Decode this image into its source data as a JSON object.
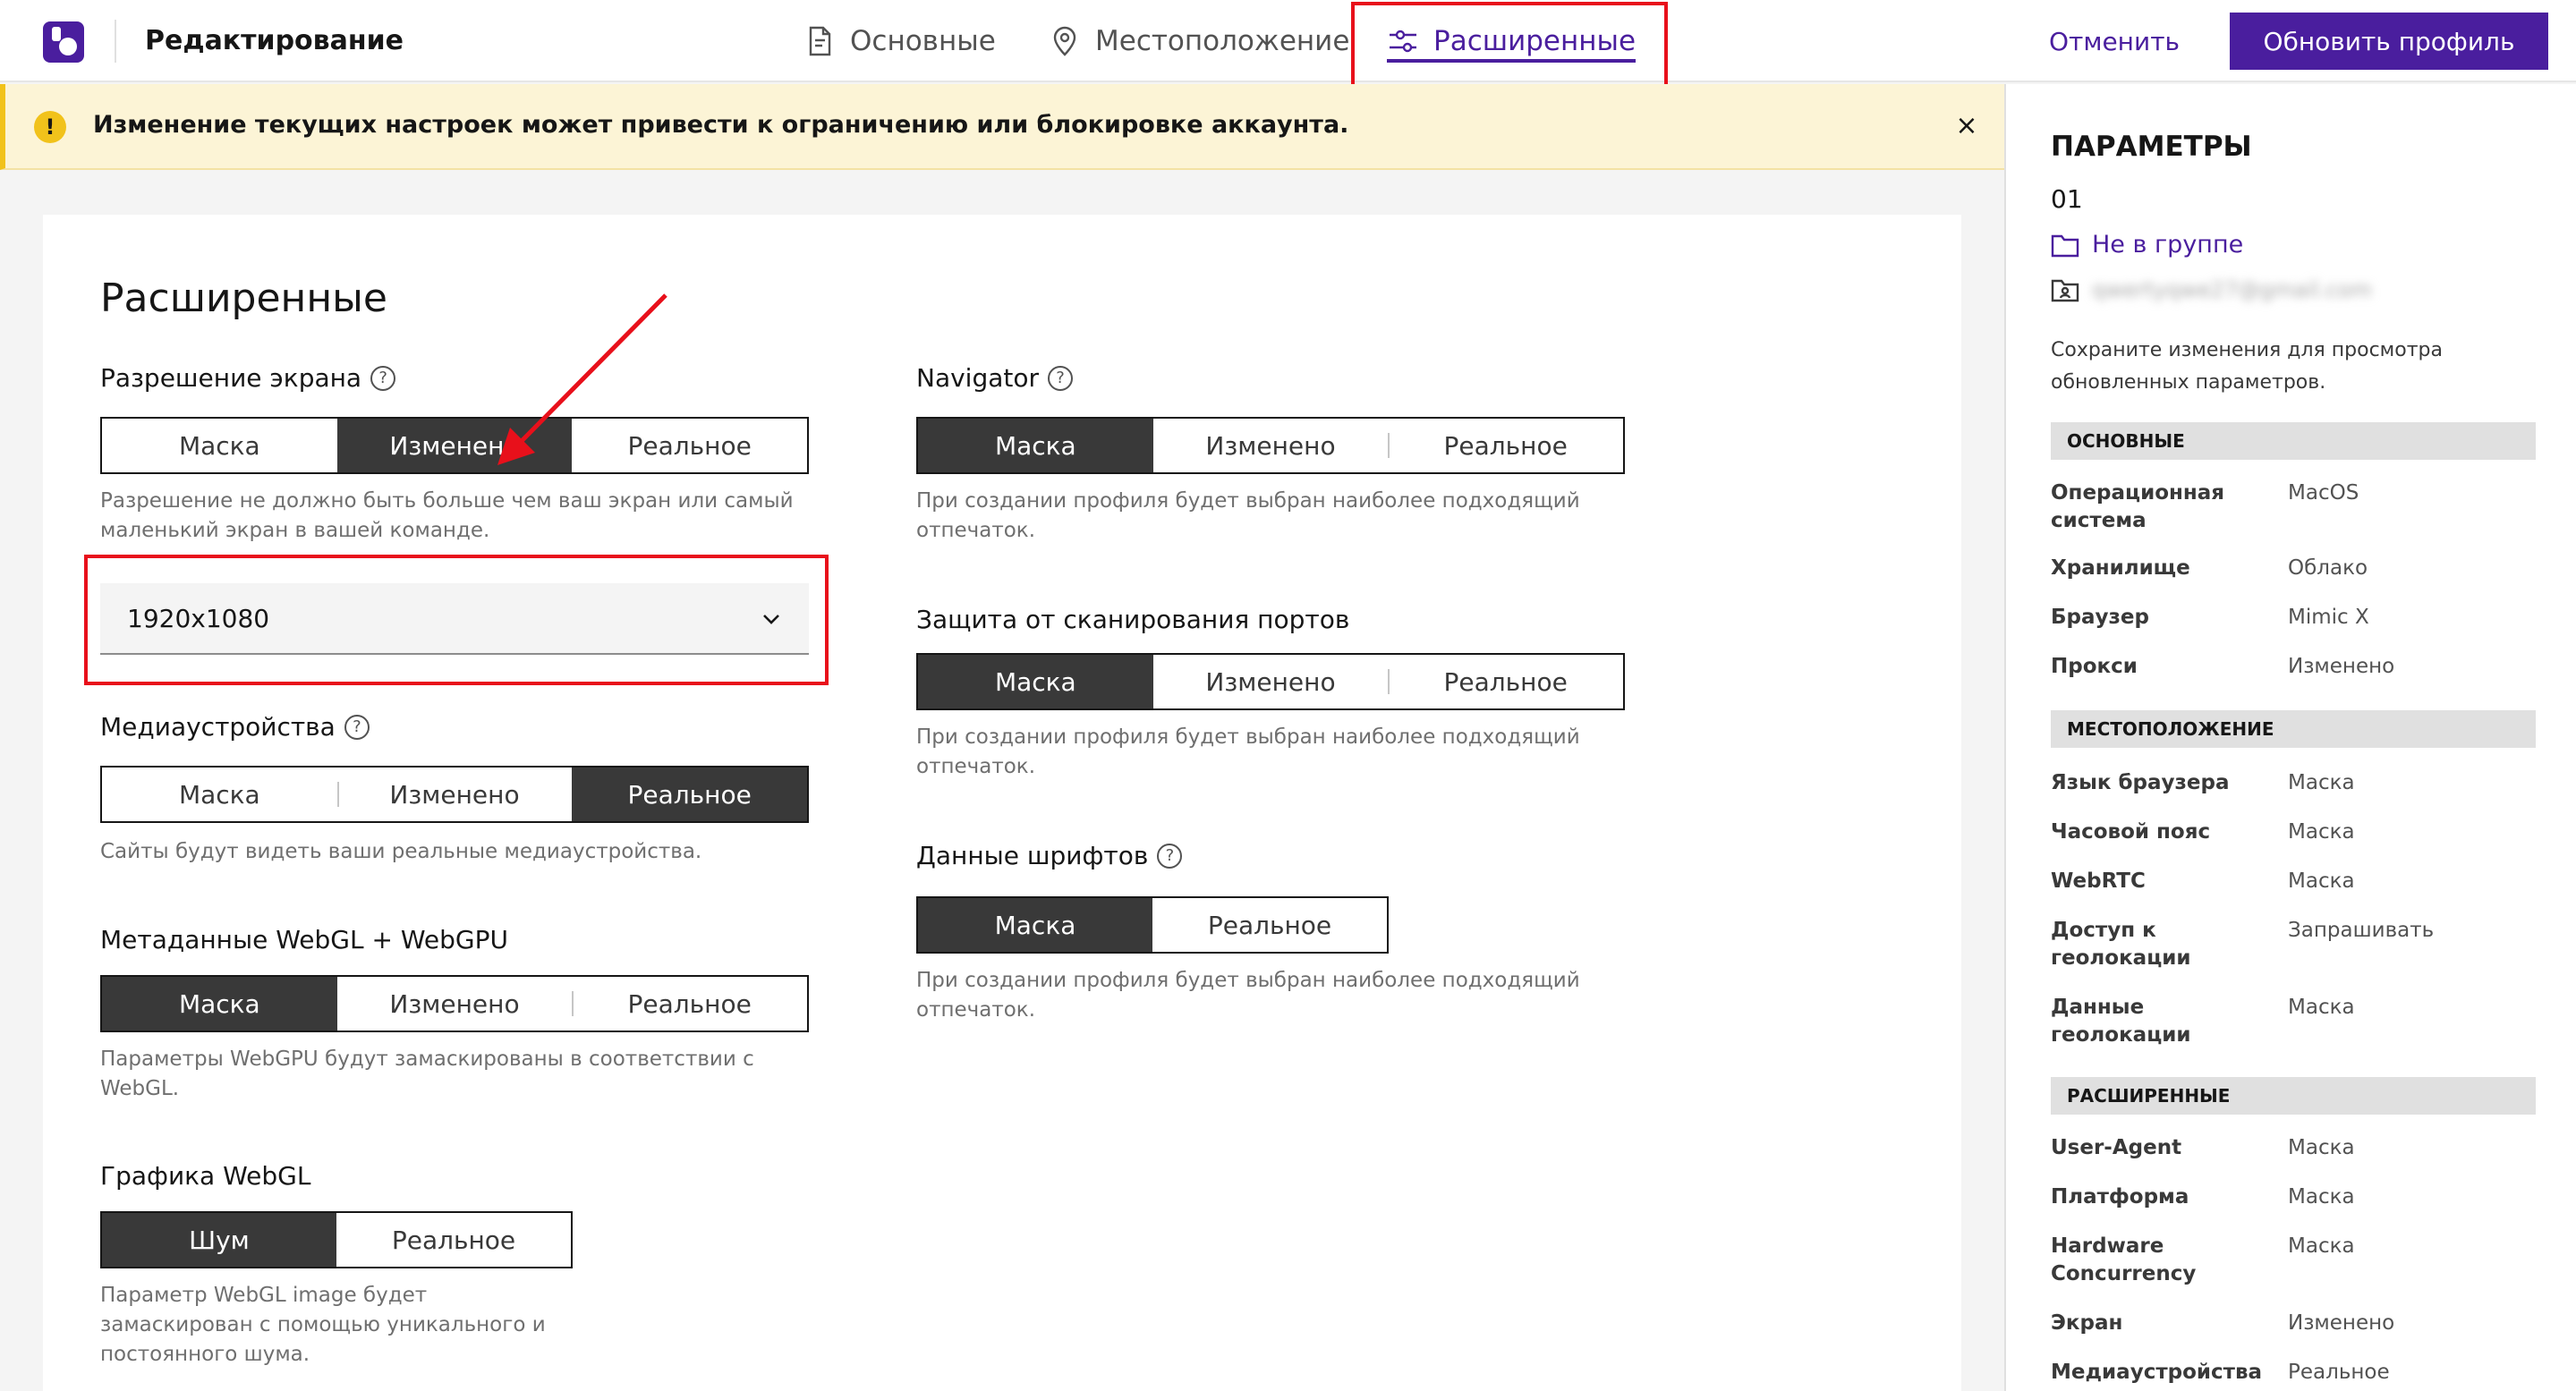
{
  "header": {
    "title": "Редактирование",
    "tabs": [
      {
        "label": "Основные",
        "icon": "document-icon"
      },
      {
        "label": "Местоположение",
        "icon": "location-pin-icon"
      },
      {
        "label": "Расширенные",
        "icon": "sliders-icon",
        "active": true
      }
    ],
    "cancel_label": "Отменить",
    "update_label": "Обновить профиль",
    "accent_color": "#4a1e9e"
  },
  "warning": {
    "icon": "!",
    "text": "Изменение текущих настроек может привести к ограничению или блокировке аккаунта.",
    "close": "×"
  },
  "main": {
    "title": "Расширенные",
    "screen_resolution": {
      "label": "Разрешение экрана",
      "options": [
        "Маска",
        "Изменено",
        "Реальное"
      ],
      "selected": "Изменено",
      "helper": "Разрешение не должно быть больше чем ваш экран или самый маленький экран в вашей команде.",
      "select_value": "1920x1080"
    },
    "media_devices": {
      "label": "Медиаустройства",
      "options": [
        "Маска",
        "Изменено",
        "Реальное"
      ],
      "selected": "Реальное",
      "helper": "Сайты будут видеть ваши реальные медиаустройства."
    },
    "webgl_meta": {
      "label": "Метаданные WebGL + WebGPU",
      "options": [
        "Маска",
        "Изменено",
        "Реальное"
      ],
      "selected": "Маска",
      "helper": "Параметры WebGPU будут замаскированы в соответствии с WebGL."
    },
    "webgl_graphics": {
      "label": "Графика WebGL",
      "options": [
        "Шум",
        "Реальное"
      ],
      "selected": "Шум",
      "helper": "Параметр WebGL image будет замаскирован с помощью уникального и постоянного шума."
    },
    "navigator": {
      "label": "Navigator",
      "options": [
        "Маска",
        "Изменено",
        "Реальное"
      ],
      "selected": "Маска",
      "helper": "При создании профиля будет выбран наиболее подходящий отпечаток."
    },
    "port_scan": {
      "label": "Защита от сканирования портов",
      "options": [
        "Маска",
        "Изменено",
        "Реальное"
      ],
      "selected": "Маска",
      "helper": "При создании профиля будет выбран наиболее подходящий отпечаток."
    },
    "fonts": {
      "label": "Данные шрифтов",
      "options": [
        "Маска",
        "Реальное"
      ],
      "selected": "Маска",
      "helper": "При создании профиля будет выбран наиболее подходящий отпечаток."
    }
  },
  "sidebar": {
    "title": "ПАРАМЕТРЫ",
    "profile_id": "01",
    "group": "Не в группе",
    "owner_email": "qwertyqwe27@gmail.com",
    "note": "Сохраните изменения для просмотра обновленных параметров.",
    "sections": [
      {
        "title": "ОСНОВНЫЕ",
        "rows": [
          {
            "k": "Операционная система",
            "v": "MacOS"
          },
          {
            "k": "Хранилище",
            "v": "Облако"
          },
          {
            "k": "Браузер",
            "v": "Mimic X"
          },
          {
            "k": "Прокси",
            "v": "Изменено"
          }
        ]
      },
      {
        "title": "МЕСТОПОЛОЖЕНИЕ",
        "rows": [
          {
            "k": "Язык браузера",
            "v": "Маска"
          },
          {
            "k": "Часовой пояс",
            "v": "Маска"
          },
          {
            "k": "WebRTC",
            "v": "Маска"
          },
          {
            "k": "Доступ к геолокации",
            "v": "Запрашивать"
          },
          {
            "k": "Данные геолокации",
            "v": "Маска"
          }
        ]
      },
      {
        "title": "РАСШИРЕННЫЕ",
        "rows": [
          {
            "k": "User-Agent",
            "v": "Маска"
          },
          {
            "k": "Платформа",
            "v": "Маска"
          },
          {
            "k": "Hardware Concurrency",
            "v": "Маска"
          },
          {
            "k": "Экран",
            "v": "Изменено"
          },
          {
            "k": "Медиаустройства",
            "v": "Реальное"
          }
        ]
      }
    ]
  }
}
